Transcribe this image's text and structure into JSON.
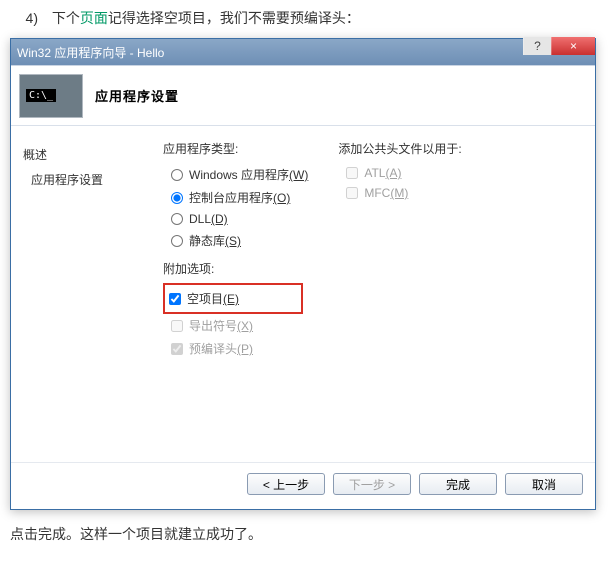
{
  "doc": {
    "step_num": "4)",
    "intro_pre": "下个",
    "intro_kw": "页面",
    "intro_post": "记得选择空项目，我们不需要预编译头：",
    "outro": "点击完成。这样一个项目就建立成功了。"
  },
  "titlebar": {
    "title": "Win32 应用程序向导 - Hello",
    "help": "?",
    "close": "×"
  },
  "banner": {
    "title": "应用程序设置"
  },
  "sidebar": {
    "overview": "概述",
    "settings": "应用程序设置"
  },
  "groups": {
    "app_type": "应用程序类型:",
    "add_headers": "添加公共头文件以用于:",
    "extra_opts": "附加选项:"
  },
  "app_type": {
    "windows": "Windows 应用程序",
    "windows_mn": "(W)",
    "console": "控制台应用程序",
    "console_mn": "(O)",
    "dll": "DLL",
    "dll_mn": "(D)",
    "static": "静态库",
    "static_mn": "(S)"
  },
  "headers": {
    "atl": "ATL",
    "atl_mn": "(A)",
    "mfc": "MFC",
    "mfc_mn": "(M)"
  },
  "extra": {
    "empty": "空项目",
    "empty_mn": "(E)",
    "export": "导出符号",
    "export_mn": "(X)",
    "precomp": "预编译头",
    "precomp_mn": "(P)"
  },
  "buttons": {
    "prev": "< 上一步",
    "next": "下一步 >",
    "finish": "完成",
    "cancel": "取消"
  }
}
